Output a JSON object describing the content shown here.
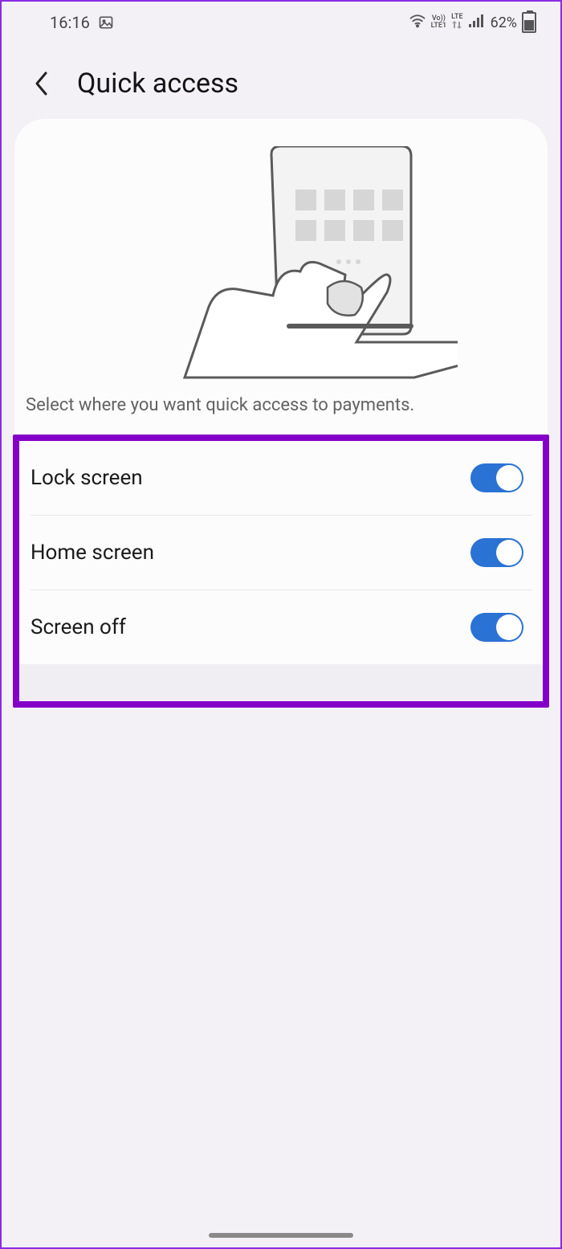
{
  "statusbar": {
    "time": "16:16",
    "battery_text": "62%",
    "network_top": "Vo))",
    "network_bot": "LTE1",
    "lte_label": "LTE"
  },
  "header": {
    "title": "Quick access"
  },
  "description": "Select where you want quick access to payments.",
  "settings": [
    {
      "label": "Lock screen",
      "on": true
    },
    {
      "label": "Home screen",
      "on": true
    },
    {
      "label": "Screen off",
      "on": true
    }
  ],
  "colors": {
    "highlight_border": "#8400c8",
    "toggle_on": "#2a72d4"
  }
}
